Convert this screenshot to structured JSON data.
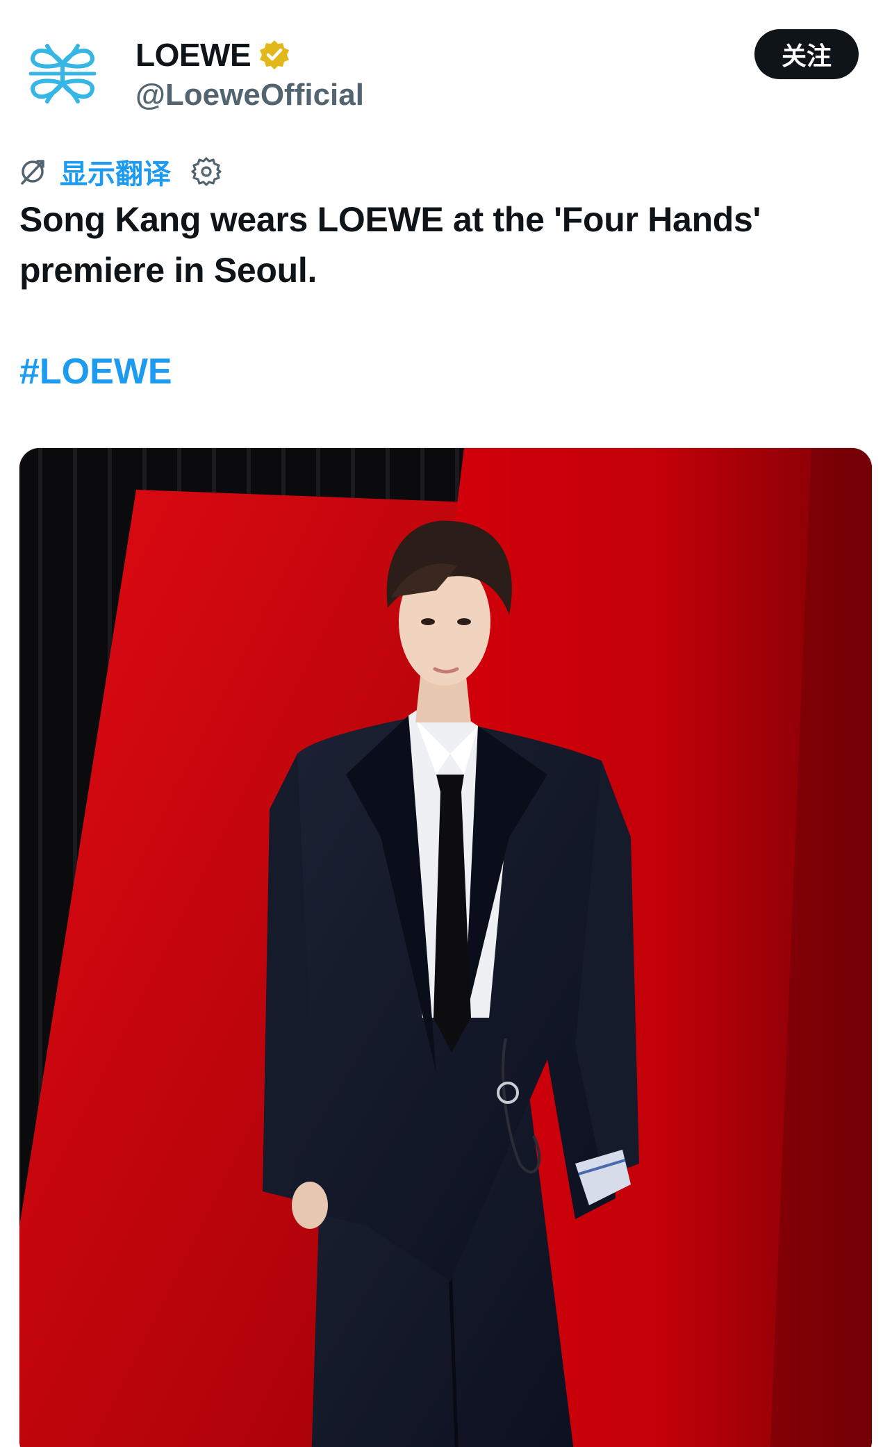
{
  "account": {
    "display_name": "LOEWE",
    "handle": "@LoeweOfficial",
    "verified_badge": "gold-verified-icon",
    "avatar_icon": "loewe-anagram-logo"
  },
  "actions": {
    "follow_label": "关注"
  },
  "translate": {
    "label": "显示翻译",
    "icon": "translate-icon",
    "settings_icon": "gear-icon"
  },
  "tweet": {
    "text": "Song Kang wears LOEWE at the 'Four Hands' premiere in Seoul.",
    "hashtag": "#LOEWE"
  },
  "media": {
    "kind": "photo"
  },
  "colors": {
    "text_primary": "#0f1419",
    "text_secondary": "#536471",
    "link": "#1d9bf0",
    "follow_bg": "#0f1419",
    "verified_gold": "#e2b719",
    "logo_blue": "#35b6e5"
  }
}
